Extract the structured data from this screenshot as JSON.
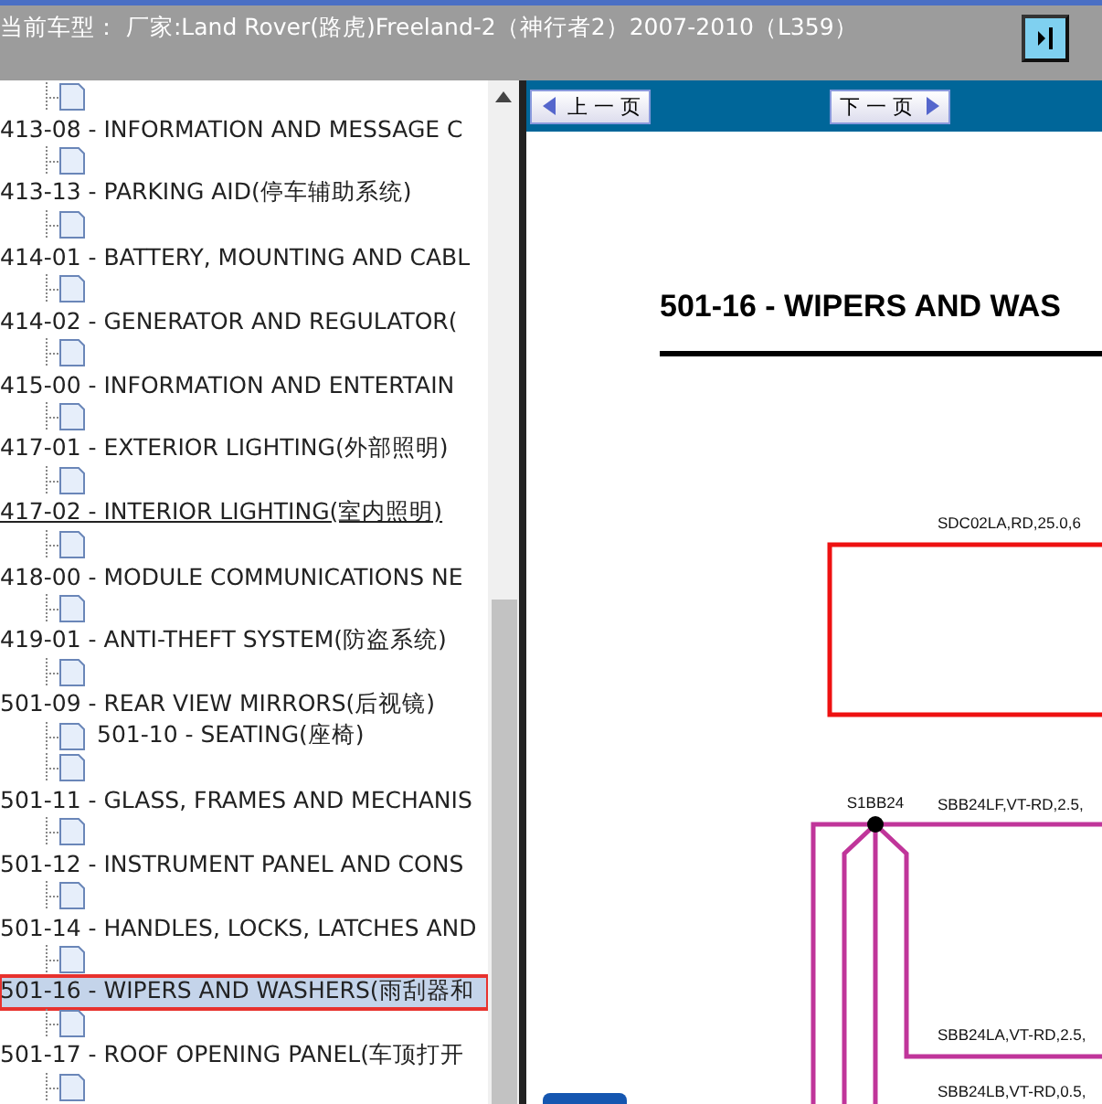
{
  "header": {
    "title": "当前车型： 厂家:Land Rover(路虎)Freeland-2（神行者2）2007-2010（L359）"
  },
  "tree": {
    "items": [
      {
        "kind": "page"
      },
      {
        "kind": "section",
        "label": "413-08 - INFORMATION AND MESSAGE C",
        "selected": false,
        "hovered": false,
        "children": [
          {
            "kind": "page"
          }
        ]
      },
      {
        "kind": "section",
        "label": "413-13 - PARKING AID(停车辅助系统)",
        "selected": false,
        "hovered": false,
        "children": [
          {
            "kind": "page"
          }
        ]
      },
      {
        "kind": "section",
        "label": "414-01 - BATTERY, MOUNTING AND CABL",
        "selected": false,
        "hovered": false,
        "children": [
          {
            "kind": "page"
          }
        ]
      },
      {
        "kind": "section",
        "label": "414-02 - GENERATOR AND REGULATOR(",
        "selected": false,
        "hovered": false,
        "children": [
          {
            "kind": "page"
          }
        ]
      },
      {
        "kind": "section",
        "label": "415-00 - INFORMATION AND ENTERTAIN",
        "selected": false,
        "hovered": false,
        "children": [
          {
            "kind": "page"
          }
        ]
      },
      {
        "kind": "section",
        "label": "417-01 - EXTERIOR LIGHTING(外部照明)",
        "selected": false,
        "hovered": false,
        "children": [
          {
            "kind": "page"
          }
        ]
      },
      {
        "kind": "section",
        "label": "417-02 - INTERIOR LIGHTING(室内照明)",
        "selected": false,
        "hovered": true,
        "children": [
          {
            "kind": "page"
          }
        ]
      },
      {
        "kind": "section",
        "label": "418-00 - MODULE COMMUNICATIONS NE",
        "selected": false,
        "hovered": false,
        "children": [
          {
            "kind": "page"
          }
        ]
      },
      {
        "kind": "section",
        "label": "419-01 - ANTI-THEFT SYSTEM(防盗系统)",
        "selected": false,
        "hovered": false,
        "children": [
          {
            "kind": "page"
          }
        ]
      },
      {
        "kind": "section",
        "label": "501-09 - REAR VIEW MIRRORS(后视镜)",
        "selected": false,
        "hovered": false,
        "children": [
          {
            "kind": "page",
            "label": "501-10 - SEATING(座椅)"
          },
          {
            "kind": "page"
          }
        ]
      },
      {
        "kind": "section",
        "label": "501-11 - GLASS, FRAMES AND MECHANIS",
        "selected": false,
        "hovered": false,
        "children": [
          {
            "kind": "page"
          }
        ]
      },
      {
        "kind": "section",
        "label": "501-12 - INSTRUMENT PANEL AND CONS",
        "selected": false,
        "hovered": false,
        "children": [
          {
            "kind": "page"
          }
        ]
      },
      {
        "kind": "section",
        "label": "501-14 - HANDLES, LOCKS, LATCHES AND",
        "selected": false,
        "hovered": false,
        "children": [
          {
            "kind": "page"
          }
        ]
      },
      {
        "kind": "section",
        "label": "501-16 - WIPERS AND WASHERS(雨刮器和",
        "selected": true,
        "hovered": false,
        "children": [
          {
            "kind": "page"
          }
        ]
      },
      {
        "kind": "section",
        "label": "501-17 - ROOF OPENING PANEL(车顶打开",
        "selected": false,
        "hovered": false,
        "children": [
          {
            "kind": "page"
          }
        ]
      }
    ]
  },
  "toolbar": {
    "buttons": [
      {
        "label": "上 一 页",
        "kind": "prev"
      },
      {
        "label": "下 一 页",
        "kind": "next"
      }
    ]
  },
  "document": {
    "title": "501-16 - WIPERS AND WAS",
    "labels": [
      {
        "text": "SDC02LA,RD,25.0,6",
        "kind": "wire"
      },
      {
        "text": "S1BB24",
        "kind": "splice"
      },
      {
        "text": "SBB24LF,VT-RD,2.5,",
        "kind": "wire"
      },
      {
        "text": "SBB24LA,VT-RD,2.5,",
        "kind": "wire"
      },
      {
        "text": "SBB24LB,VT-RD,0.5,",
        "kind": "wire"
      }
    ]
  }
}
